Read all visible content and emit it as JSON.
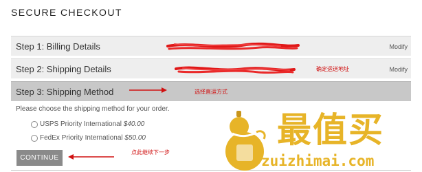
{
  "page": {
    "title": "SECURE CHECKOUT"
  },
  "steps": [
    {
      "label": "Step 1: Billing Details",
      "action": "Modify"
    },
    {
      "label": "Step 2: Shipping Details",
      "action": "Modify"
    },
    {
      "label": "Step 3: Shipping Method"
    }
  ],
  "shipping_method": {
    "instructions": "Please choose the shipping method for your order.",
    "options": [
      {
        "name": "USPS Priority International",
        "price": "$40.00",
        "selected": false
      },
      {
        "name": "FedEx Priority International",
        "price": "$50.00",
        "selected": false
      }
    ],
    "continue_label": "CONTINUE"
  },
  "annotations": {
    "shipping_address_note": "确定运送地址",
    "shipping_method_note": "选择直运方式",
    "continue_note": "点此继续下一步",
    "color": "#d01010"
  },
  "watermark": {
    "chars": "最值买",
    "url": "zuizhimai.com",
    "color": "#e7b428"
  }
}
